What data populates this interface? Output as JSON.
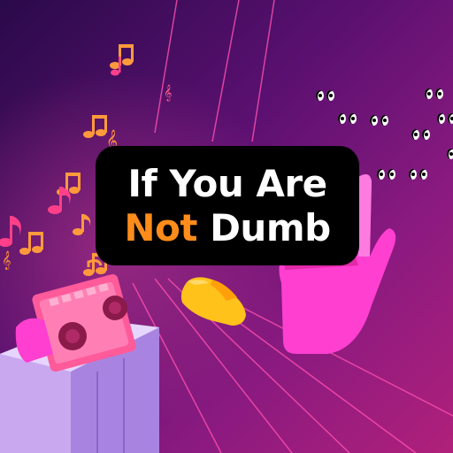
{
  "title": {
    "line1": "If You Are",
    "line2_highlight": "Not",
    "line2_rest": "Dumb"
  },
  "colors": {
    "background_dark": "#2a0a4a",
    "background_light": "#b0207a",
    "card": "#000000",
    "title_white": "#ffffff",
    "title_orange": "#ff8c1a",
    "notes": "#ff9a3c",
    "hand_pink": "#ff3fd0",
    "hand_yellow": "#ffc21a",
    "radio": "#ff5a9a",
    "pedestal": "#c9a8f0"
  },
  "icons": [
    "music-note-icon",
    "treble-clef-icon",
    "boombox-icon",
    "pink-hand-icon",
    "yellow-hand-icon",
    "glowing-eyes-icon"
  ]
}
